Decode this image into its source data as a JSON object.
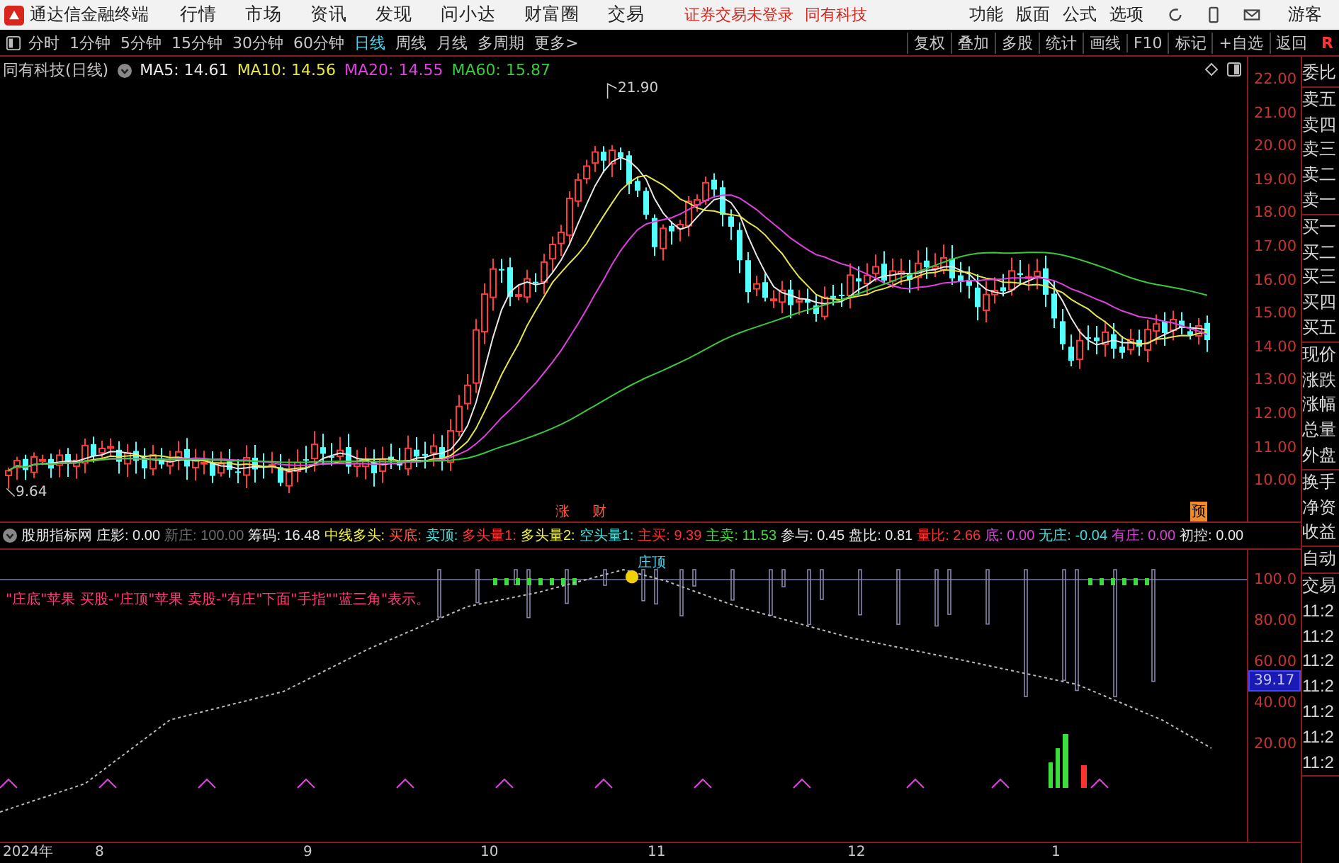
{
  "title_bar": {
    "app_name": "通达信金融终端",
    "menu": [
      "行情",
      "市场",
      "资讯",
      "发现",
      "问小达",
      "财富圈",
      "交易"
    ],
    "notice": "证券交易未登录",
    "stock_link": "同有科技",
    "right_menu": [
      "功能",
      "版面",
      "公式",
      "选项"
    ],
    "user": "游客"
  },
  "toolbar": {
    "periods": [
      {
        "label": "分时",
        "selected": false
      },
      {
        "label": "1分钟",
        "selected": false
      },
      {
        "label": "5分钟",
        "selected": false
      },
      {
        "label": "15分钟",
        "selected": false
      },
      {
        "label": "30分钟",
        "selected": false
      },
      {
        "label": "60分钟",
        "selected": false
      },
      {
        "label": "日线",
        "selected": true
      },
      {
        "label": "周线",
        "selected": false
      },
      {
        "label": "月线",
        "selected": false
      },
      {
        "label": "多周期",
        "selected": false
      }
    ],
    "more": "更多",
    "more_caret": ">",
    "tools": [
      "复权",
      "叠加",
      "多股",
      "统计",
      "画线",
      "F10",
      "标记",
      "+自选",
      "返回"
    ],
    "badge": "R"
  },
  "main_chart": {
    "title": "同有科技(日线)",
    "ma": [
      {
        "text": "MA5: 14.61",
        "color": "#e8e8e8"
      },
      {
        "text": "MA10: 14.56",
        "color": "#e6e64c"
      },
      {
        "text": "MA20: 14.55",
        "color": "#e040e0"
      },
      {
        "text": "MA60: 15.87",
        "color": "#3cc83c"
      }
    ],
    "high_label": "21.90",
    "low_label": "9.64",
    "markers": [
      {
        "text": "涨",
        "kind": "plain"
      },
      {
        "text": "财",
        "kind": "plain"
      },
      {
        "text": "预",
        "kind": "boxed"
      }
    ],
    "yticks": [
      "22.00",
      "21.00",
      "20.00",
      "19.00",
      "18.00",
      "17.00",
      "16.00",
      "15.00",
      "14.00",
      "13.00",
      "12.00",
      "11.00",
      "10.00"
    ]
  },
  "indicator": {
    "name": "股朋指标网",
    "items": [
      {
        "text": "庄影: 0.00",
        "color": "#e8e8e8"
      },
      {
        "text": "新庄: 100.00",
        "color": "#6e6e6e"
      },
      {
        "text": "筹码: 16.48",
        "color": "#e8e8e8"
      },
      {
        "text": "中线多头:",
        "color": "#f0f040"
      },
      {
        "text": "买底:",
        "color": "#ff5a3c"
      },
      {
        "text": "卖顶:",
        "color": "#40e0e0"
      },
      {
        "text": "多头量1:",
        "color": "#ff3232"
      },
      {
        "text": "多头量2:",
        "color": "#f0f040"
      },
      {
        "text": "空头量1:",
        "color": "#40e0e0"
      },
      {
        "text": "主买: 9.39",
        "color": "#ff3232"
      },
      {
        "text": "主卖: 11.53",
        "color": "#3cdc3c"
      },
      {
        "text": "参与: 0.45",
        "color": "#e8e8e8"
      },
      {
        "text": "盘比: 0.81",
        "color": "#e8e8e8"
      },
      {
        "text": "量比: 2.66",
        "color": "#ff3232"
      },
      {
        "text": "底: 0.00",
        "color": "#e040e0"
      },
      {
        "text": "无庄: -0.04",
        "color": "#40e0e0"
      },
      {
        "text": "有庄: 0.00",
        "color": "#e040e0"
      },
      {
        "text": "初控: 0.00",
        "color": "#e8e8e8"
      }
    ],
    "note": "\"庄底\"苹果 买股-\"庄顶\"苹果 卖股-\"有庄\"下面\"手指\"\"蓝三角\"表示。",
    "top_label": "庄顶",
    "yticks": [
      "100.0",
      "80.00",
      "60.00",
      "40.00",
      "20.00"
    ],
    "current_value": "39.17"
  },
  "time_axis": [
    "2024年",
    "8",
    "9",
    "10",
    "11",
    "12",
    "1"
  ],
  "sidebar": {
    "groups": [
      {
        "items": [
          "委比"
        ]
      },
      {
        "items": [
          "卖五",
          "卖四",
          "卖三",
          "卖二",
          "卖一"
        ]
      },
      {
        "items": [
          "买一",
          "买二",
          "买三",
          "买四",
          "买五"
        ]
      },
      {
        "items": [
          "现价",
          "涨跌",
          "涨幅",
          "总量",
          "外盘"
        ]
      },
      {
        "items": [
          "换手",
          "净资",
          "收益"
        ]
      },
      {
        "items": [
          "自动"
        ]
      },
      {
        "items": [
          "交易",
          "11:2",
          "11:2",
          "11:2",
          "11:2",
          "11:2",
          "11:2",
          "11:2"
        ]
      }
    ]
  }
}
